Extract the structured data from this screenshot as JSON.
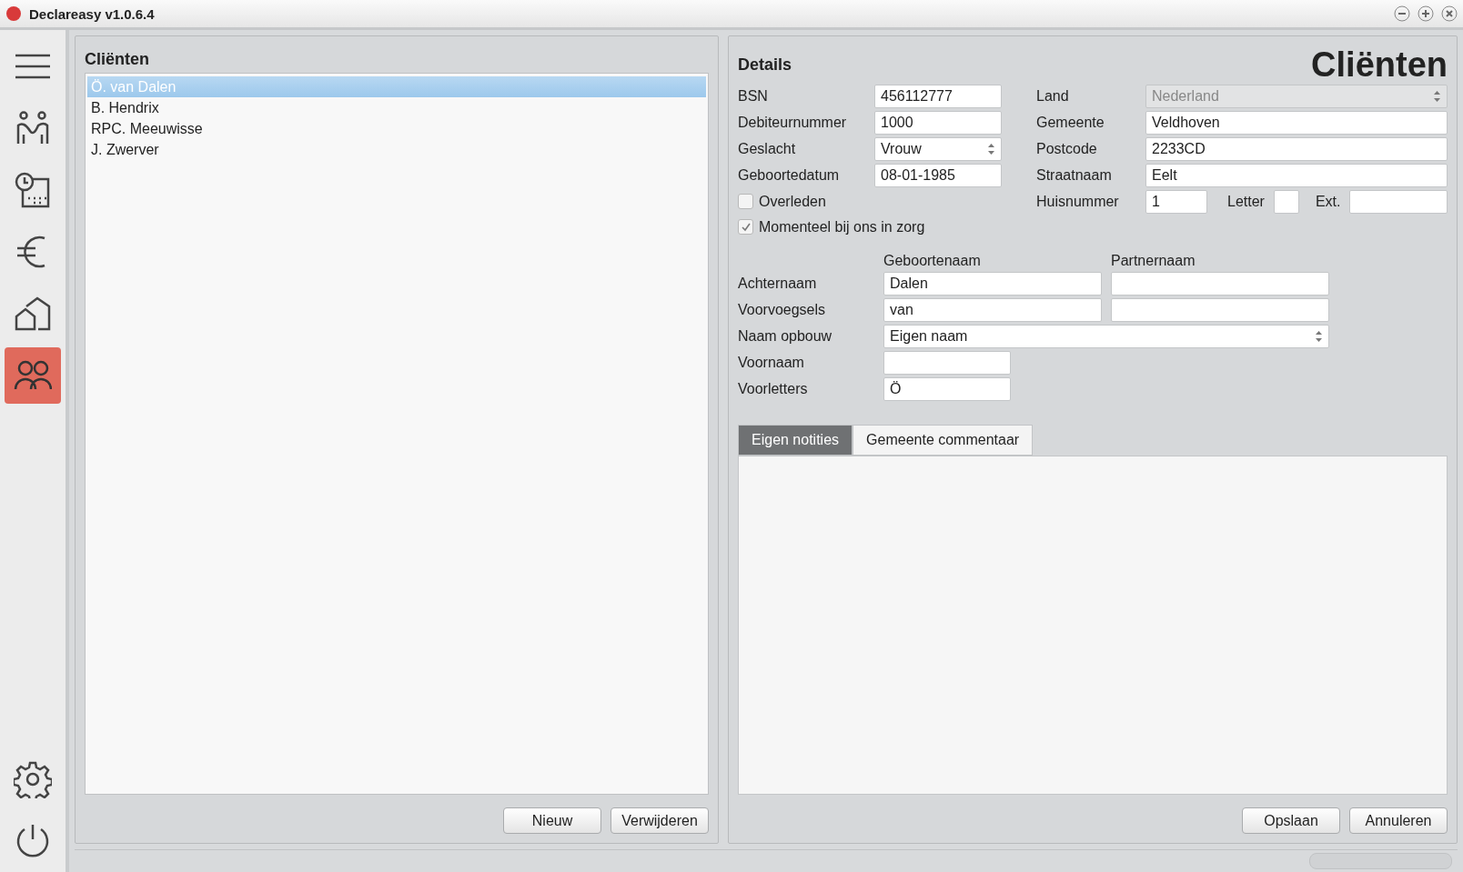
{
  "window": {
    "title": "Declareasy v1.0.6.4"
  },
  "sidebar": {
    "items": [
      {
        "kind": "menu",
        "selected": false
      },
      {
        "kind": "couple",
        "selected": false
      },
      {
        "kind": "schedule",
        "selected": false
      },
      {
        "kind": "euro",
        "selected": false
      },
      {
        "kind": "houses",
        "selected": false
      },
      {
        "kind": "group",
        "selected": true
      }
    ],
    "bottom_items": [
      {
        "kind": "settings",
        "selected": false
      },
      {
        "kind": "power",
        "selected": false
      }
    ]
  },
  "client_list": {
    "title": "Cliënten",
    "items": [
      {
        "label": "Ö. van Dalen",
        "selected": true
      },
      {
        "label": "B. Hendrix",
        "selected": false
      },
      {
        "label": "RPC. Meeuwisse",
        "selected": false
      },
      {
        "label": "J. Zwerver",
        "selected": false
      }
    ],
    "buttons": [
      "Nieuw",
      "Verwijderen"
    ]
  },
  "details": {
    "title": "Details",
    "page_heading": "Cliënten",
    "left_fields": [
      {
        "kind": "text",
        "label": "BSN",
        "value": "456112777"
      },
      {
        "kind": "text",
        "label": "Debiteurnummer",
        "value": "1000"
      },
      {
        "kind": "select",
        "label": "Geslacht",
        "value": "Vrouw"
      },
      {
        "kind": "text",
        "label": "Geboortedatum",
        "value": "08-01-1985"
      }
    ],
    "checkboxes": [
      {
        "label": "Overleden",
        "checked": false
      },
      {
        "label": "Momenteel bij ons in zorg",
        "checked": true
      }
    ],
    "right_fields": [
      {
        "kind": "select",
        "label": "Land",
        "value": "Nederland",
        "disabled": true
      },
      {
        "kind": "text",
        "label": "Gemeente",
        "value": "Veldhoven",
        "disabled": false
      },
      {
        "kind": "text",
        "label": "Postcode",
        "value": "2233CD",
        "disabled": false
      },
      {
        "kind": "text",
        "label": "Straatnaam",
        "value": "Eelt",
        "disabled": false
      }
    ],
    "house": {
      "label": "Huisnummer",
      "value": "1",
      "letter_label": "Letter",
      "ext_label": "Ext."
    },
    "name_columns": [
      "Geboortenaam",
      "Partnernaam"
    ],
    "name_rows": [
      {
        "label": "Achternaam",
        "values": [
          "Dalen"
        ]
      },
      {
        "label": "Voorvoegsels",
        "values": [
          "van"
        ]
      }
    ],
    "name_build": {
      "label": "Naam opbouw",
      "value": "Eigen naam"
    },
    "first_fields": [
      {
        "label": "Voornaam"
      },
      {
        "label": "Voorletters",
        "value": "Ö"
      }
    ],
    "tabs": [
      {
        "label": "Eigen notities",
        "selected": true
      },
      {
        "label": "Gemeente commentaar",
        "selected": false
      }
    ],
    "buttons": [
      "Opslaan",
      "Annuleren"
    ]
  }
}
